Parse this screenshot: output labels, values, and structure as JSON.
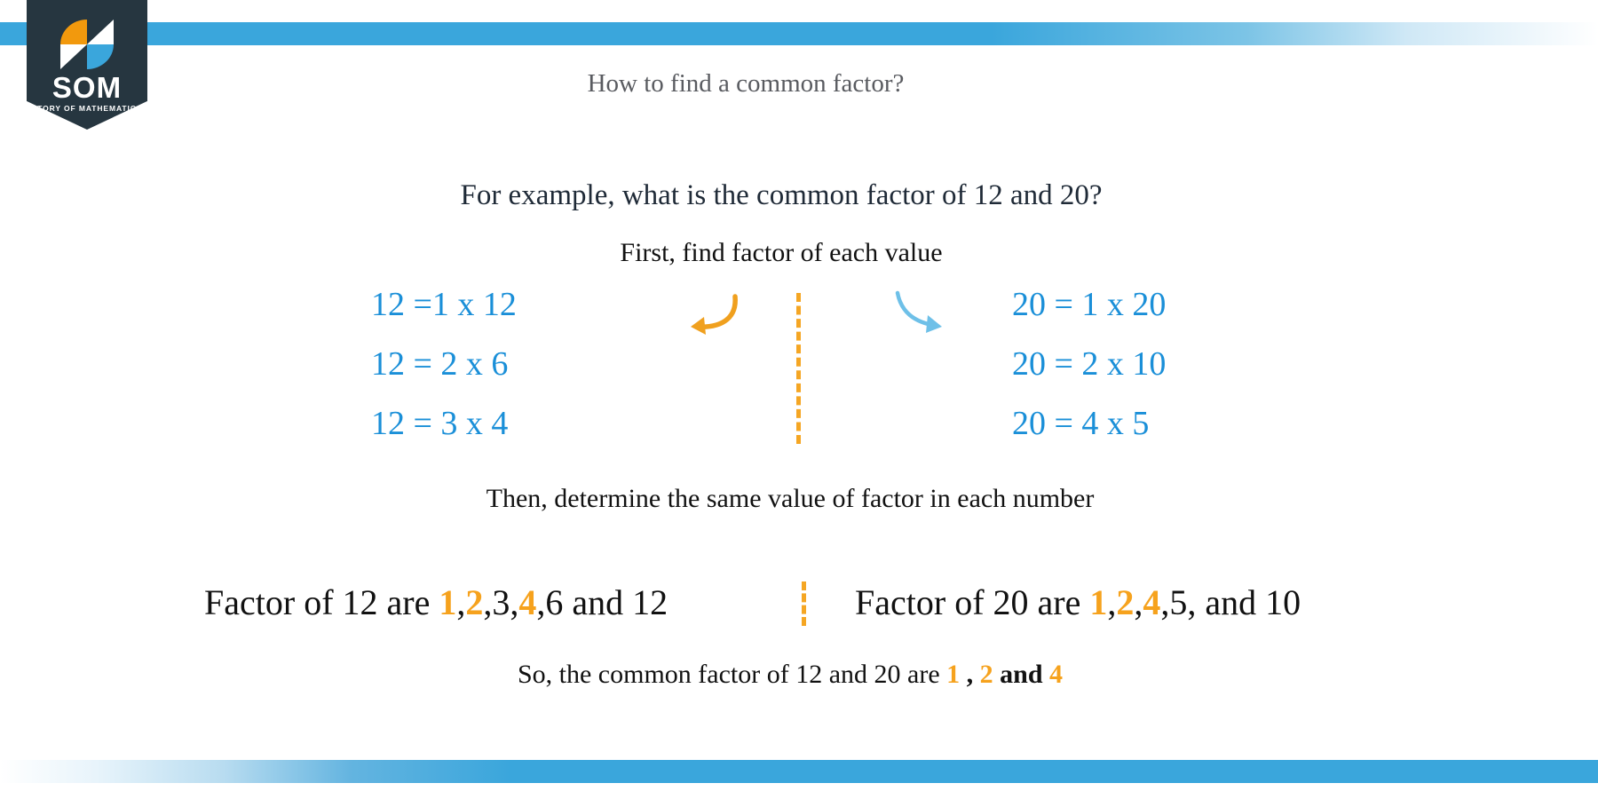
{
  "brand": {
    "wordmark": "SOM",
    "tagline": "STORY OF MATHEMATICS",
    "navy": "#263640",
    "orange": "#f2990d",
    "blue": "#3aa6dc"
  },
  "colors": {
    "bar_blue": "#3aa6dc",
    "equation_blue": "#1a8fd8",
    "highlight_orange": "#f6a21d",
    "dash_orange": "#f5a623",
    "title_gray": "#595b60",
    "body_dark": "#111111",
    "arrow_orange": "#f0a01e",
    "arrow_blue": "#6ec0e8"
  },
  "content": {
    "title": "How to find a common factor?",
    "example_line": "For example, what is the common factor of 12 and 20?",
    "step1_line": "First, find factor of each value",
    "step2_line": "Then, determine the same value of factor in each number",
    "left_equations": [
      "12 =1 x 12",
      "12 = 2 x 6",
      "12 = 3 x 4"
    ],
    "right_equations": [
      "20 = 1 x 20",
      "20 = 2 x 10",
      "20 = 4 x 5"
    ],
    "factor_12": {
      "prefix": "Factor of 12 are ",
      "parts": [
        {
          "text": "1",
          "highlight": true
        },
        {
          "text": ",",
          "highlight": false
        },
        {
          "text": "2",
          "highlight": true
        },
        {
          "text": ",3,",
          "highlight": false
        },
        {
          "text": "4",
          "highlight": true
        },
        {
          "text": ",6 and 12",
          "highlight": false
        }
      ],
      "plain": "Factor of 12 are 1,2,3,4,6 and 12"
    },
    "factor_20": {
      "prefix": "Factor of 20 are ",
      "parts": [
        {
          "text": "1",
          "highlight": true
        },
        {
          "text": ",",
          "highlight": false
        },
        {
          "text": "2",
          "highlight": true
        },
        {
          "text": ",",
          "highlight": false
        },
        {
          "text": "4",
          "highlight": true
        },
        {
          "text": ",5, and 10",
          "highlight": false
        }
      ],
      "plain": "Factor of 20 are 1,2,4,5, and 10"
    },
    "conclusion": {
      "prefix": "So, the common factor of 12 and 20 are ",
      "v1": "1",
      "sep1": " , ",
      "v2": "2",
      "sep2": " and ",
      "v3": "4",
      "plain": "So, the common factor of 12 and 20 are 1 , 2 and 4"
    }
  },
  "icons": {
    "arrow_curve_left": "arrow-curve-left-icon",
    "arrow_curve_right": "arrow-curve-right-icon",
    "dashed_divider": "dashed-divider-icon",
    "som_logo": "som-logo-icon"
  }
}
